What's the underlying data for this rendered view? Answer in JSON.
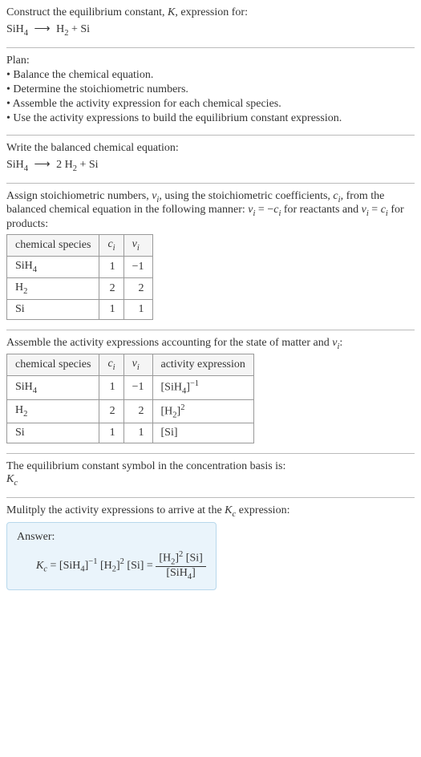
{
  "prompt": {
    "line1_pre": "Construct the equilibrium constant, ",
    "line1_K": "K",
    "line1_post": ", expression for:",
    "eq_lhs": "SiH",
    "eq_lhs_sub": "4",
    "arrow": "⟶",
    "eq_rhs_h": "H",
    "eq_rhs_h_sub": "2",
    "eq_rhs_plus": " + Si"
  },
  "plan": {
    "title": "Plan:",
    "items": [
      "• Balance the chemical equation.",
      "• Determine the stoichiometric numbers.",
      "• Assemble the activity expression for each chemical species.",
      "• Use the activity expressions to build the equilibrium constant expression."
    ]
  },
  "balanced": {
    "title": "Write the balanced chemical equation:",
    "lhs": "SiH",
    "lhs_sub": "4",
    "arrow": "⟶",
    "coef": "2 H",
    "h_sub": "2",
    "tail": " + Si"
  },
  "assign": {
    "text_pre": "Assign stoichiometric numbers, ",
    "nu_i": "ν",
    "nu_sub": "i",
    "text_mid1": ", using the stoichiometric coefficients, ",
    "c_i": "c",
    "c_sub": "i",
    "text_mid2": ", from the balanced chemical equation in the following manner: ",
    "eq1_lhs": "ν",
    "eq1_lhs_sub": "i",
    "eq1_eq": " = −",
    "eq1_rhs": "c",
    "eq1_rhs_sub": "i",
    "text_mid3": " for reactants and ",
    "eq2_lhs": "ν",
    "eq2_lhs_sub": "i",
    "eq2_eq": " = ",
    "eq2_rhs": "c",
    "eq2_rhs_sub": "i",
    "text_post": " for products:"
  },
  "table1": {
    "headers": {
      "species": "chemical species",
      "c": "c",
      "c_sub": "i",
      "nu": "ν",
      "nu_sub": "i"
    },
    "rows": [
      {
        "species_a": "SiH",
        "species_sub": "4",
        "species_b": "",
        "c": "1",
        "nu": "−1"
      },
      {
        "species_a": "H",
        "species_sub": "2",
        "species_b": "",
        "c": "2",
        "nu": "2"
      },
      {
        "species_a": "Si",
        "species_sub": "",
        "species_b": "",
        "c": "1",
        "nu": "1"
      }
    ]
  },
  "assemble": {
    "text_pre": "Assemble the activity expressions accounting for the state of matter and ",
    "nu": "ν",
    "nu_sub": "i",
    "text_post": ":"
  },
  "table2": {
    "headers": {
      "species": "chemical species",
      "c": "c",
      "c_sub": "i",
      "nu": "ν",
      "nu_sub": "i",
      "activity": "activity expression"
    },
    "rows": [
      {
        "species_a": "SiH",
        "species_sub": "4",
        "c": "1",
        "nu": "−1",
        "act_pre": "[SiH",
        "act_sub": "4",
        "act_mid": "]",
        "act_sup": "−1"
      },
      {
        "species_a": "H",
        "species_sub": "2",
        "c": "2",
        "nu": "2",
        "act_pre": "[H",
        "act_sub": "2",
        "act_mid": "]",
        "act_sup": "2"
      },
      {
        "species_a": "Si",
        "species_sub": "",
        "c": "1",
        "nu": "1",
        "act_pre": "[Si]",
        "act_sub": "",
        "act_mid": "",
        "act_sup": ""
      }
    ]
  },
  "symbol": {
    "text": "The equilibrium constant symbol in the concentration basis is:",
    "K": "K",
    "K_sub": "c"
  },
  "multiply": {
    "text_pre": "Mulitply the activity expressions to arrive at the ",
    "K": "K",
    "K_sub": "c",
    "text_post": " expression:"
  },
  "answer": {
    "title": "Answer:",
    "Kc_K": "K",
    "Kc_sub": "c",
    "eq": " = ",
    "t1_pre": "[SiH",
    "t1_sub": "4",
    "t1_mid": "]",
    "t1_sup": "−1",
    "sp1": " ",
    "t2_pre": "[H",
    "t2_sub": "2",
    "t2_mid": "]",
    "t2_sup": "2",
    "sp2": " ",
    "t3": "[Si]",
    "eq2": " = ",
    "frac_num_a": "[H",
    "frac_num_a_sub": "2",
    "frac_num_a_mid": "]",
    "frac_num_a_sup": "2",
    "frac_num_sp": " ",
    "frac_num_b": "[Si]",
    "frac_den_a": "[SiH",
    "frac_den_a_sub": "4",
    "frac_den_b": "]"
  }
}
